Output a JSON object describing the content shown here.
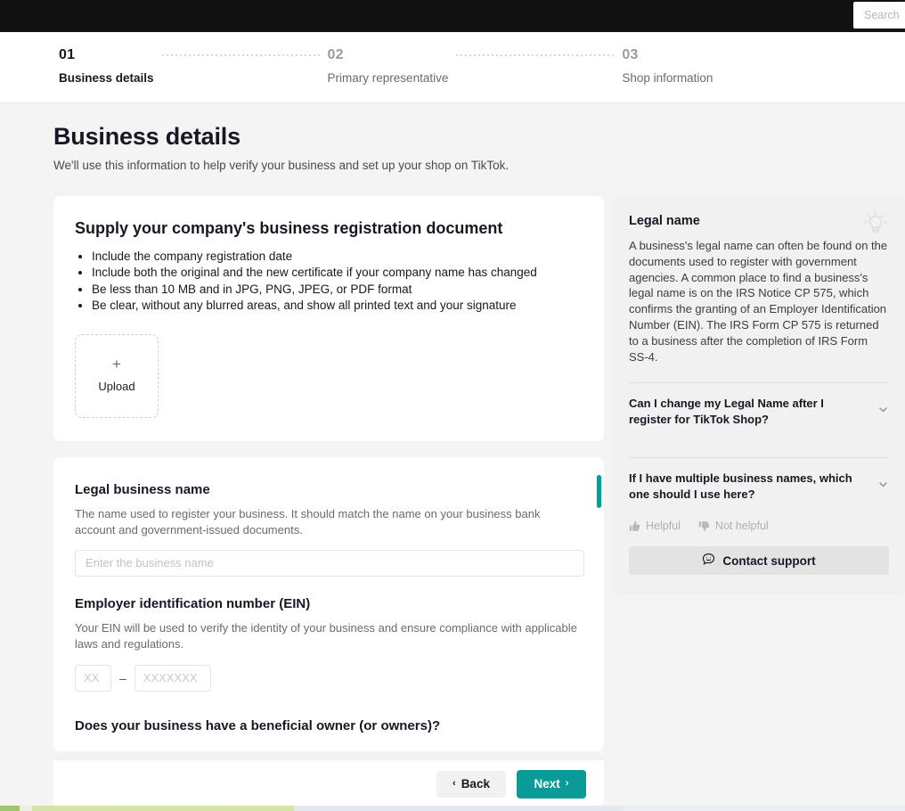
{
  "topbar": {
    "search_placeholder": "Search",
    "search_value": "",
    "background": "#121212"
  },
  "stepper": {
    "steps": [
      {
        "number": "01",
        "label": "Business details",
        "state": "active"
      },
      {
        "number": "02",
        "label": "Primary representative",
        "state": "upcoming"
      },
      {
        "number": "03",
        "label": "Shop information",
        "state": "upcoming"
      }
    ]
  },
  "page": {
    "title": "Business details",
    "subtitle": "We'll use this information to help verify your business and set up your shop on TikTok."
  },
  "upload_card": {
    "title": "Supply your company's business registration document",
    "requirements": [
      "Include the company registration date",
      "Include both the original and the new certificate if your company name has changed",
      "Be less than 10 MB and in JPG, PNG, JPEG, or PDF format",
      "Be clear, without any blurred areas, and show all printed text and your signature"
    ],
    "upload": {
      "plus": "+",
      "label": "Upload"
    }
  },
  "form_card": {
    "legal_business_name": {
      "label": "Legal business name",
      "help": "The name used to register your business. It should match the name on your business bank account and government-issued documents.",
      "placeholder": "Enter the business name",
      "value": ""
    },
    "ein": {
      "label": "Employer identification number (EIN)",
      "help": "Your EIN will be used to verify the identity of your business and ensure compliance with applicable laws and regulations.",
      "prefix_placeholder": "XX",
      "prefix_value": "",
      "separator": "–",
      "suffix_placeholder": "XXXXXXX",
      "suffix_value": ""
    },
    "beneficial_owner_question": "Does your business have a beneficial owner (or owners)?",
    "scrollbar_color": "#0a9b96"
  },
  "help_panel": {
    "icon": "lightbulb-icon",
    "title": "Legal name",
    "body": "A business's legal name can often be found on the documents used to register with government agencies. A common place to find a business's legal name is on the IRS Notice CP 575, which confirms the granting of an Employer Identification Number (EIN). The IRS Form CP 575 is returned to a business after the completion of IRS Form SS-4.",
    "faqs": [
      {
        "question": "Can I change my Legal Name after I register for TikTok Shop?",
        "expanded": false
      },
      {
        "question": "If I have multiple business names, which one should I use here?",
        "expanded": false
      }
    ],
    "feedback": {
      "helpful_label": "Helpful",
      "not_helpful_label": "Not helpful"
    },
    "support_button": "Contact support"
  },
  "footer": {
    "back_label": "Back",
    "next_label": "Next",
    "back_arrow": "‹",
    "next_arrow": "›",
    "next_color": "#0a9b96"
  }
}
